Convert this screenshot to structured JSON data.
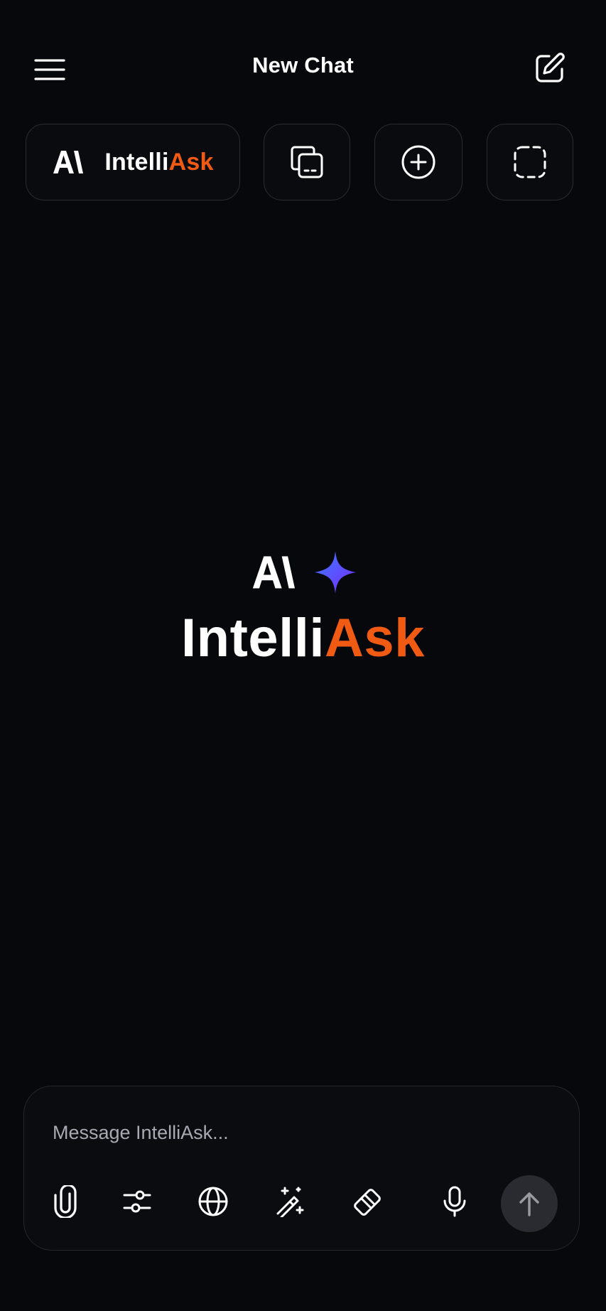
{
  "header": {
    "title": "New Chat",
    "menu_icon": "hamburger-menu-icon",
    "edit_icon": "edit-square-icon"
  },
  "toolbar": {
    "brand": {
      "logo_icon": "ai-logo-icon",
      "name_part1": "Intelli",
      "name_part2": "Ask"
    },
    "buttons": [
      {
        "icon": "copy-icon"
      },
      {
        "icon": "plus-circle-icon"
      },
      {
        "icon": "dashed-select-icon"
      }
    ]
  },
  "hero": {
    "logo_icon": "ai-logo-icon",
    "sparkle_icon": "sparkle-icon",
    "name_part1": "Intelli",
    "name_part2": "Ask"
  },
  "composer": {
    "placeholder": "Message IntelliAsk...",
    "value": "",
    "tools": [
      {
        "icon": "paperclip-icon"
      },
      {
        "icon": "sliders-icon"
      },
      {
        "icon": "globe-icon"
      },
      {
        "icon": "magic-wand-icon"
      },
      {
        "icon": "eraser-icon"
      },
      {
        "icon": "microphone-icon"
      }
    ],
    "send_icon": "arrow-up-icon"
  },
  "colors": {
    "background": "#07080c",
    "accent": "#f05a13",
    "sparkle_start": "#3b7bff",
    "sparkle_end": "#7a2bff",
    "border": "#2a2c33"
  }
}
